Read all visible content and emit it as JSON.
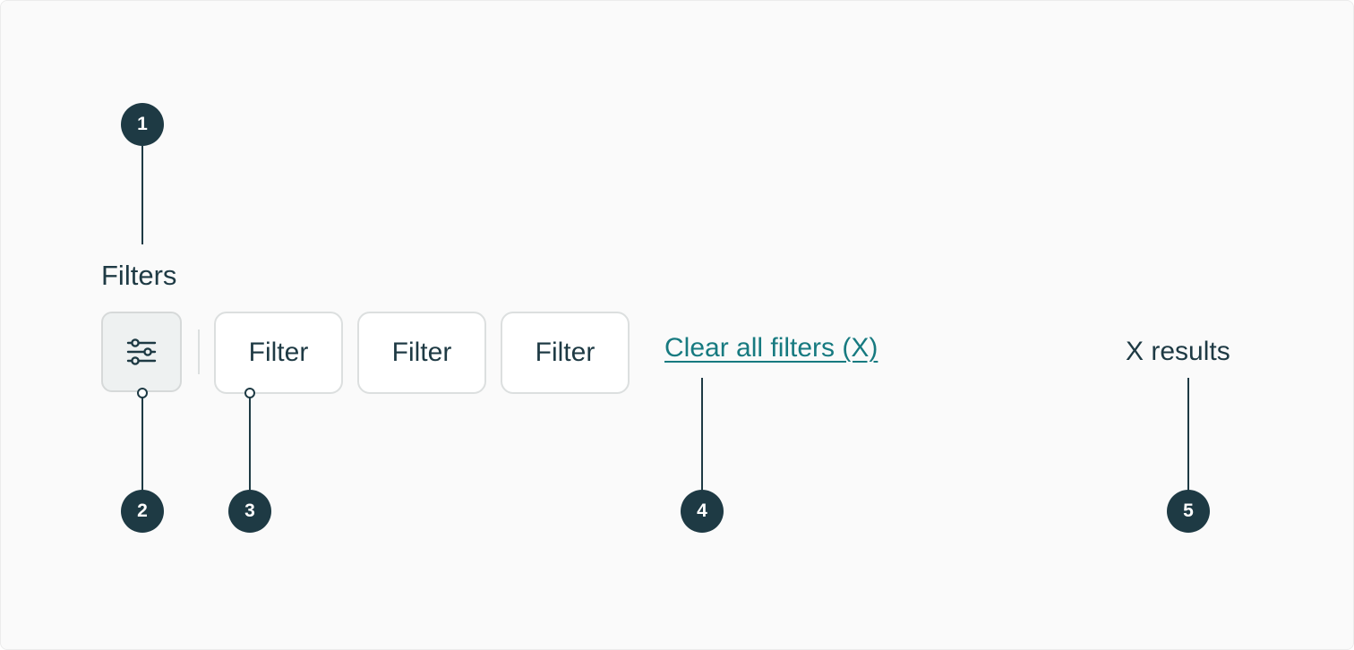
{
  "filters_label": "Filters",
  "filter_button": {
    "icon": "sliders-icon"
  },
  "chips": [
    {
      "label": "Filter"
    },
    {
      "label": "Filter"
    },
    {
      "label": "Filter"
    }
  ],
  "clear_link": "Clear all filters (X)",
  "results": "X results",
  "markers": [
    "1",
    "2",
    "3",
    "4",
    "5"
  ],
  "colors": {
    "marker": "#1e3a44",
    "link": "#177a80",
    "text": "#1e3a44",
    "chip_border": "#dcdfdf",
    "icon_button_bg": "#eef1f1"
  }
}
